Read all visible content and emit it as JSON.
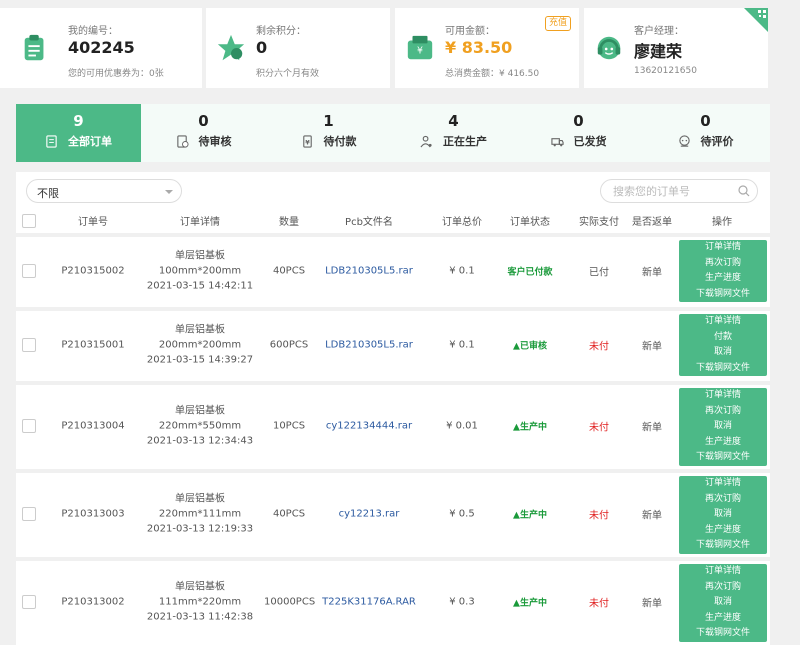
{
  "cards": [
    {
      "label": "我的编号：",
      "value": "402245",
      "sub": "您的可用优惠券为：0张",
      "icon": "clipboard-icon"
    },
    {
      "label": "剩余积分：",
      "value": "0",
      "sub": "积分六个月有效",
      "icon": "star-icon"
    },
    {
      "label": "可用金额：",
      "value": "¥ 83.50",
      "sub": "总消费金额：¥ 416.50",
      "badge": "充值",
      "icon": "wallet-icon"
    },
    {
      "label": "客户经理：",
      "value": "廖建荣",
      "sub": "13620121650",
      "icon": "headset-icon"
    }
  ],
  "tabs": [
    {
      "count": "9",
      "label": "全部订单",
      "icon": "list-icon",
      "active": true
    },
    {
      "count": "0",
      "label": "待审核",
      "icon": "review-icon"
    },
    {
      "count": "1",
      "label": "待付款",
      "icon": "payment-icon"
    },
    {
      "count": "4",
      "label": "正在生产",
      "icon": "worker-icon"
    },
    {
      "count": "0",
      "label": "已发货",
      "icon": "truck-icon"
    },
    {
      "count": "0",
      "label": "待评价",
      "icon": "comment-icon"
    }
  ],
  "filter": {
    "selected": "不限"
  },
  "search": {
    "placeholder": "搜索您的订单号"
  },
  "columns": [
    "订单号",
    "订单详情",
    "数量",
    "Pcb文件名",
    "订单总价",
    "订单状态",
    "实际支付",
    "是否返单",
    "操作"
  ],
  "rows": [
    {
      "order_no": "P210315002",
      "type": "单层铝基板",
      "size": "100mm*200mm",
      "time": "2021-03-15 14:42:11",
      "qty": "40PCS",
      "file": "LDB210305L5.rar",
      "total": "¥ 0.1",
      "status": "客户已付款",
      "paid": "已付",
      "reorder": "新单",
      "actions": [
        "订单详情",
        "再次订购",
        "生产进度",
        "下载钢网文件"
      ]
    },
    {
      "order_no": "P210315001",
      "type": "单层铝基板",
      "size": "200mm*200mm",
      "time": "2021-03-15 14:39:27",
      "qty": "600PCS",
      "file": "LDB210305L5.rar",
      "total": "¥ 0.1",
      "status": "▲已审核",
      "paid": "未付",
      "reorder": "新单",
      "actions": [
        "订单详情",
        "付款",
        "取消",
        "下载钢网文件"
      ]
    },
    {
      "order_no": "P210313004",
      "type": "单层铝基板",
      "size": "220mm*550mm",
      "time": "2021-03-13 12:34:43",
      "qty": "10PCS",
      "file": "cy122134444.rar",
      "total": "¥ 0.01",
      "status": "▲生产中",
      "paid": "未付",
      "reorder": "新单",
      "actions": [
        "订单详情",
        "再次订购",
        "取消",
        "生产进度",
        "下载钢网文件"
      ]
    },
    {
      "order_no": "P210313003",
      "type": "单层铝基板",
      "size": "220mm*111mm",
      "time": "2021-03-13 12:19:33",
      "qty": "40PCS",
      "file": "cy12213.rar",
      "total": "¥ 0.5",
      "status": "▲生产中",
      "paid": "未付",
      "reorder": "新单",
      "actions": [
        "订单详情",
        "再次订购",
        "取消",
        "生产进度",
        "下载钢网文件"
      ]
    },
    {
      "order_no": "P210313002",
      "type": "单层铝基板",
      "size": "111mm*220mm",
      "time": "2021-03-13 11:42:38",
      "qty": "10000PCS",
      "file": "T225K31176A.RAR",
      "total": "¥ 0.3",
      "status": "▲生产中",
      "paid": "未付",
      "reorder": "新单",
      "actions": [
        "订单详情",
        "再次订购",
        "取消",
        "生产进度",
        "下载钢网文件"
      ]
    }
  ],
  "colors": {
    "accent": "#4cb987",
    "money": "#f0a020",
    "status_green": "#1a9a3a",
    "unpaid_red": "#e02020",
    "link_blue": "#2c5aa0"
  }
}
